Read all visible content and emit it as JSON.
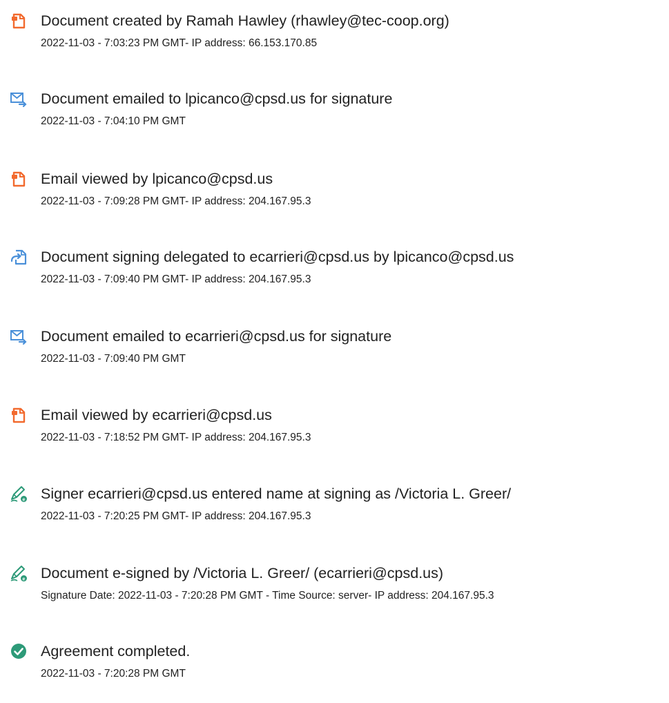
{
  "events": [
    {
      "icon": "document-created-icon",
      "title": "Document created by Ramah Hawley (rhawley@tec-coop.org)",
      "detail": "2022-11-03 - 7:03:23 PM GMT- IP address: 66.153.170.85"
    },
    {
      "icon": "email-sent-icon",
      "title": "Document emailed to lpicanco@cpsd.us for signature",
      "detail": "2022-11-03 - 7:04:10 PM GMT"
    },
    {
      "icon": "document-viewed-icon",
      "title": "Email viewed by lpicanco@cpsd.us",
      "detail": "2022-11-03 - 7:09:28 PM GMT- IP address: 204.167.95.3"
    },
    {
      "icon": "delegate-icon",
      "title": "Document signing delegated to ecarrieri@cpsd.us by lpicanco@cpsd.us",
      "detail": "2022-11-03 - 7:09:40 PM GMT- IP address: 204.167.95.3"
    },
    {
      "icon": "email-sent-icon",
      "title": "Document emailed to ecarrieri@cpsd.us for signature",
      "detail": "2022-11-03 - 7:09:40 PM GMT"
    },
    {
      "icon": "document-viewed-icon",
      "title": "Email viewed by ecarrieri@cpsd.us",
      "detail": "2022-11-03 - 7:18:52 PM GMT- IP address: 204.167.95.3"
    },
    {
      "icon": "signature-pen-icon",
      "title": "Signer ecarrieri@cpsd.us entered name at signing as /Victoria L. Greer/",
      "detail": "2022-11-03 - 7:20:25 PM GMT- IP address: 204.167.95.3"
    },
    {
      "icon": "signature-pen-icon",
      "title": "Document e-signed by /Victoria L. Greer/ (ecarrieri@cpsd.us)",
      "detail": "Signature Date: 2022-11-03 - 7:20:28 PM GMT - Time Source: server- IP address: 204.167.95.3"
    },
    {
      "icon": "check-circle-icon",
      "title": "Agreement completed.",
      "detail": "2022-11-03 - 7:20:28 PM GMT"
    }
  ],
  "colors": {
    "orange": "#f26a2e",
    "blue": "#4a90d9",
    "green": "#2d9a78",
    "text": "#222222"
  }
}
